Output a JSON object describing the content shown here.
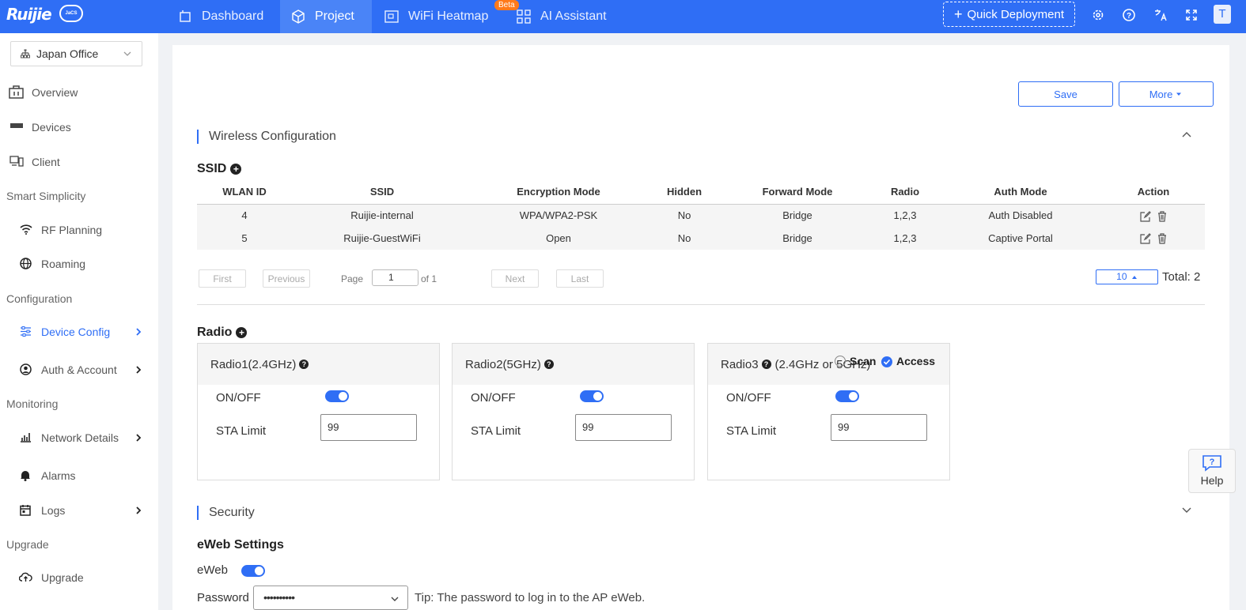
{
  "topbar": {
    "brand": "Ruijie",
    "brand_sub": "JaCS",
    "nav": [
      {
        "label": "Dashboard",
        "icon": "dashboard-icon"
      },
      {
        "label": "Project",
        "icon": "cube-icon"
      },
      {
        "label": "WiFi Heatmap",
        "icon": "heatmap-icon"
      },
      {
        "label": "AI Assistant",
        "icon": "grid-icon"
      }
    ],
    "beta": "Beta",
    "quick_deployment": "Quick Deployment",
    "avatar": "T"
  },
  "sidebar": {
    "site": "Japan Office",
    "items": [
      {
        "label": "Overview"
      },
      {
        "label": "Devices"
      },
      {
        "label": "Client"
      },
      {
        "label": "Smart Simplicity"
      },
      {
        "label": "RF Planning"
      },
      {
        "label": "Roaming"
      },
      {
        "label": "Configuration"
      },
      {
        "label": "Device Config"
      },
      {
        "label": "Auth & Account"
      },
      {
        "label": "Monitoring"
      },
      {
        "label": "Network Details"
      },
      {
        "label": "Alarms"
      },
      {
        "label": "Logs"
      },
      {
        "label": "Upgrade"
      },
      {
        "label": "Upgrade"
      }
    ]
  },
  "main": {
    "save": "Save",
    "more": "More",
    "wireless_title": "Wireless Configuration",
    "ssid_title": "SSID",
    "columns": [
      "WLAN ID",
      "SSID",
      "Encryption Mode",
      "Hidden",
      "Forward Mode",
      "Radio",
      "Auth Mode",
      "Action"
    ],
    "rows": [
      [
        "4",
        "Ruijie-internal",
        "WPA/WPA2-PSK",
        "No",
        "Bridge",
        "1,2,3",
        "Auth Disabled"
      ],
      [
        "5",
        "Ruijie-GuestWiFi",
        "Open",
        "No",
        "Bridge",
        "1,2,3",
        "Captive Portal"
      ]
    ],
    "pager": {
      "first": "First",
      "previous": "Previous",
      "page": "Page",
      "page_value": "1",
      "of": "of 1",
      "next": "Next",
      "last": "Last",
      "page_size": "10",
      "total": "Total: 2"
    },
    "radio_title": "Radio",
    "radios": [
      {
        "name": "Radio1(2.4GHz)",
        "onoff": "ON/OFF",
        "sta": "STA Limit",
        "sta_value": "99"
      },
      {
        "name": "Radio2(5GHz)",
        "onoff": "ON/OFF",
        "sta": "STA Limit",
        "sta_value": "99"
      },
      {
        "name": "Radio3",
        "band": "(2.4GHz or 5GHz)",
        "onoff": "ON/OFF",
        "sta": "STA Limit",
        "sta_value": "99",
        "scan": "Scan",
        "access": "Access"
      }
    ],
    "security_title": "Security",
    "eweb_title": "eWeb Settings",
    "eweb_label": "eWeb",
    "password_label": "Password",
    "password_value": "••••••••••",
    "tip": "Tip: The password to log in to the AP eWeb."
  },
  "help": "Help"
}
